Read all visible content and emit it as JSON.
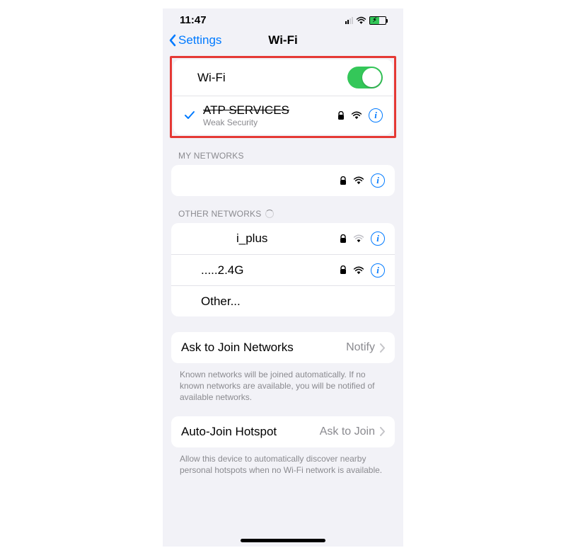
{
  "status": {
    "time": "11:47"
  },
  "nav": {
    "back_label": "Settings",
    "title": "Wi-Fi"
  },
  "wifi_toggle": {
    "label": "Wi-Fi",
    "on": true
  },
  "connected_network": {
    "name": "ATP SERVICES",
    "subtitle": "Weak Security",
    "locked": true
  },
  "sections": {
    "my_networks": {
      "header": "MY NETWORKS",
      "items": [
        {
          "name": "",
          "locked": true
        }
      ]
    },
    "other_networks": {
      "header": "OTHER NETWORKS",
      "items": [
        {
          "name": "i_plus",
          "locked": true
        },
        {
          "name": ".....2.4G",
          "locked": true
        }
      ],
      "other_label": "Other..."
    }
  },
  "ask_to_join": {
    "label": "Ask to Join Networks",
    "value": "Notify",
    "footer": "Known networks will be joined automatically. If no known networks are available, you will be notified of available networks."
  },
  "auto_join": {
    "label": "Auto-Join Hotspot",
    "value": "Ask to Join",
    "footer": "Allow this device to automatically discover nearby personal hotspots when no Wi-Fi network is available."
  },
  "colors": {
    "accent": "#007aff",
    "toggle_on": "#34c759",
    "highlight_border": "#e53935"
  }
}
